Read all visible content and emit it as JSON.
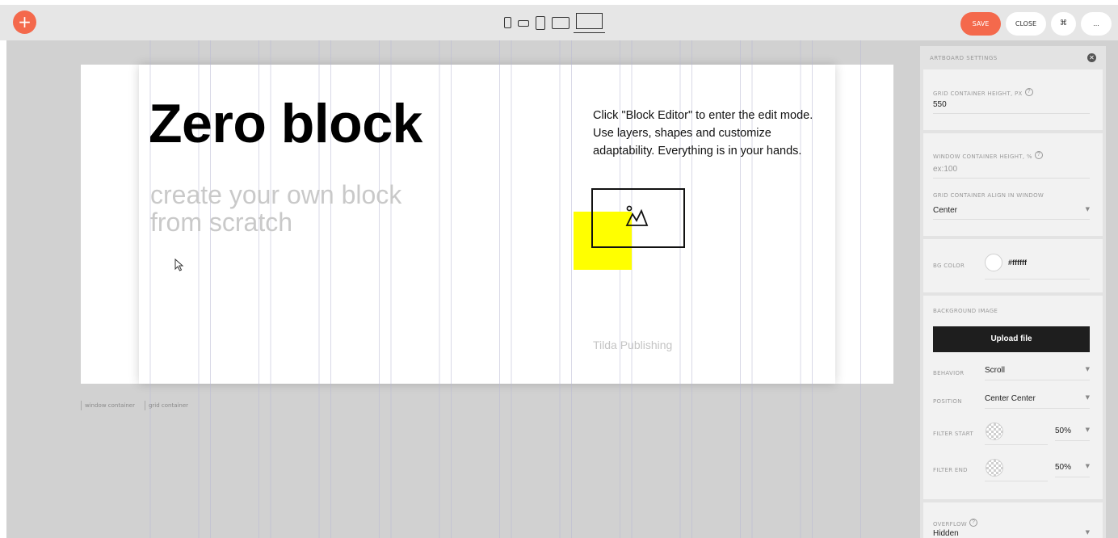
{
  "toolbar": {
    "add_label": "+",
    "save_label": "SAVE",
    "close_label": "CLOSE",
    "shortcut_label": "⌘",
    "more_label": "...",
    "accent_color": "#f4694c"
  },
  "canvas": {
    "title": "Zero block",
    "subtitle": "create your own block from scratch",
    "description": "Click \"Block Editor\" to enter the edit mode. Use layers, shapes and customize adaptability. Everything is in your hands.",
    "brand": "Tilda Publishing",
    "label_window": "window container",
    "label_grid": "grid container",
    "shape_color": "#ffff00"
  },
  "panel": {
    "title": "ARTBOARD SETTINGS",
    "grid_height_label": "GRID CONTAINER HEIGHT, PX",
    "grid_height_value": "550",
    "window_height_label": "WINDOW CONTAINER HEIGHT, %",
    "window_height_placeholder": "ex:100",
    "grid_align_label": "GRID CONTAINER ALIGN IN WINDOW",
    "grid_align_value": "Center",
    "bg_color_label": "BG COLOR",
    "bg_color_value": "#ffffff",
    "bg_image_label": "BACKGROUND IMAGE",
    "upload_label": "Upload file",
    "behavior_label": "BEHAVIOR",
    "behavior_value": "Scroll",
    "position_label": "POSITION",
    "position_value": "Center Center",
    "filter_start_label": "FILTER START",
    "filter_start_value": "50%",
    "filter_end_label": "FILTER END",
    "filter_end_value": "50%",
    "overflow_label": "OVERFLOW",
    "overflow_value": "Hidden"
  }
}
